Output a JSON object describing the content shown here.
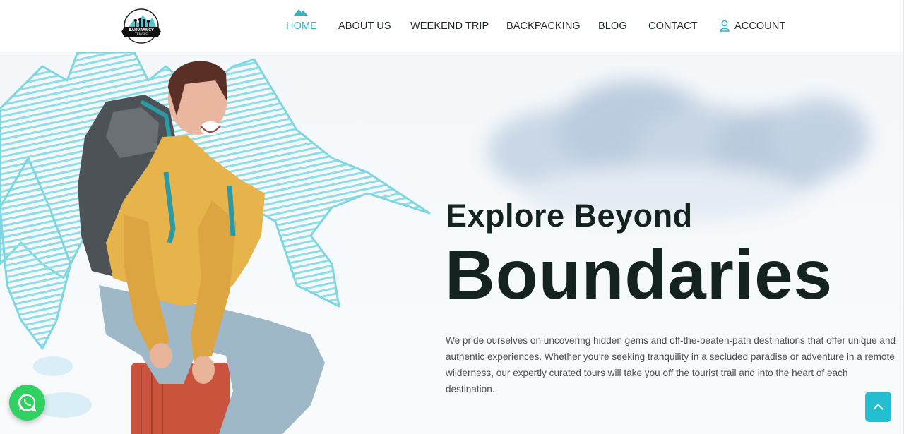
{
  "brand": {
    "logo_text_top": "BAHURANGY",
    "logo_text_bottom": "TRAVELS"
  },
  "nav": {
    "items": [
      {
        "label": "HOME",
        "active": true
      },
      {
        "label": "ABOUT US"
      },
      {
        "label": "WEEKEND TRIP"
      },
      {
        "label": "BACKPACKING"
      },
      {
        "label": "BLOG"
      },
      {
        "label": "CONTACT"
      }
    ],
    "account_label": "ACCOUNT"
  },
  "hero": {
    "subtitle": "Explore Beyond",
    "title": "Boundaries",
    "description": "We pride ourselves on uncovering hidden gems and off-the-beaten-path destinations that offer unique and authentic experiences. Whether you're seeking tranquility in a secluded paradise or adventure in a remote wilderness, our expertly curated tours will take you off the tourist trail and into the heart of each destination."
  },
  "icons": {
    "whatsapp": "whatsapp-icon",
    "scroll_top": "chevron-up-icon",
    "account": "user-icon"
  },
  "colors": {
    "accent": "#2bb3c4",
    "heading": "#14231f",
    "whatsapp": "#2fd160",
    "scroll_button": "#23bfd0"
  }
}
